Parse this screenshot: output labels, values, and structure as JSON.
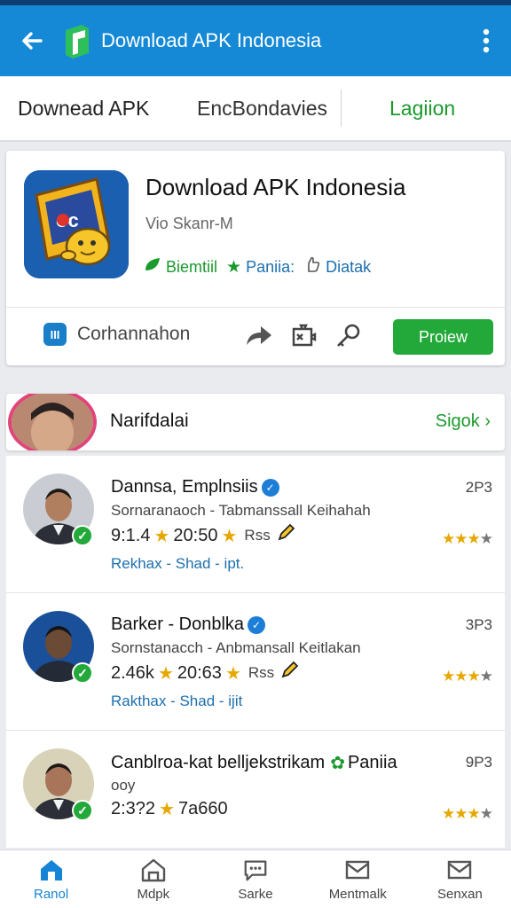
{
  "topbar": {
    "title": "Download APK Indonesia"
  },
  "tabs": [
    {
      "label": "Downead APK"
    },
    {
      "label": "EncBondavies"
    },
    {
      "label": "Lagiion"
    }
  ],
  "app": {
    "name": "Download APK Indonesia",
    "developer": "Vio Skanr-M",
    "stats": [
      {
        "label": "Biemtiil",
        "icon": "leaf-icon"
      },
      {
        "label": "Paniia:",
        "icon": "star-icon"
      },
      {
        "label": "Diatak",
        "icon": "hand-icon"
      }
    ],
    "category": "Corhannahon",
    "install_label": "Proiew",
    "accent": "#23a83a"
  },
  "section": {
    "title": "Narifdalai",
    "link": "Sigok"
  },
  "reviews": [
    {
      "name": "Dannsa, Emplnsiis",
      "subtitle": "Sornaranaoch - Tabmanssall Keihahah",
      "stat1": "9:1.4",
      "stat2": "20:50",
      "stat3": "Rss",
      "links": "Rekhax - Shad - ipt.",
      "num": "2P3",
      "stars_on": 3
    },
    {
      "name": "Barker - Donblka",
      "subtitle": "Sornstanacch - Anbmansall Keitlakan",
      "stat1": "2.46k",
      "stat2": "20:63",
      "stat3": "Rss",
      "links": "Rakthax - Shad - ijit",
      "num": "3P3",
      "stars_on": 3
    },
    {
      "name": "Canblroa-kat belljekstrikam",
      "name_extra": "Paniia",
      "subtitle": "ooy",
      "stat1": "2:3?2",
      "stat2": "7a660",
      "stat3": "",
      "links": "",
      "num": "9P3",
      "stars_on": 3
    }
  ],
  "bottomnav": [
    {
      "label": "Ranol",
      "icon": "home-icon"
    },
    {
      "label": "Mdpk",
      "icon": "house-outline-icon"
    },
    {
      "label": "Sarke",
      "icon": "chat-icon"
    },
    {
      "label": "Mentmalk",
      "icon": "mail-icon"
    },
    {
      "label": "Senxan",
      "icon": "envelope-icon"
    }
  ]
}
